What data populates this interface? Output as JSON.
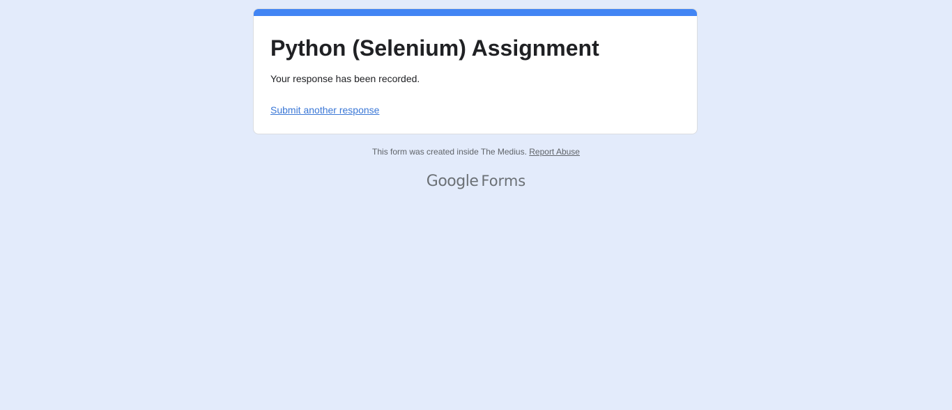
{
  "form": {
    "title": "Python (Selenium) Assignment",
    "confirmation_message": "Your response has been recorded.",
    "submit_another_label": "Submit another response"
  },
  "footer": {
    "created_note": "This form was created inside The Medius.",
    "report_abuse_label": "Report Abuse"
  },
  "branding": {
    "google_label": "Google",
    "forms_label": "Forms"
  },
  "colors": {
    "page_background": "#e3ebfb",
    "accent_bar": "#4285f4",
    "link": "#3a77d6",
    "title_text": "#202124",
    "muted_text": "#5f6368"
  }
}
